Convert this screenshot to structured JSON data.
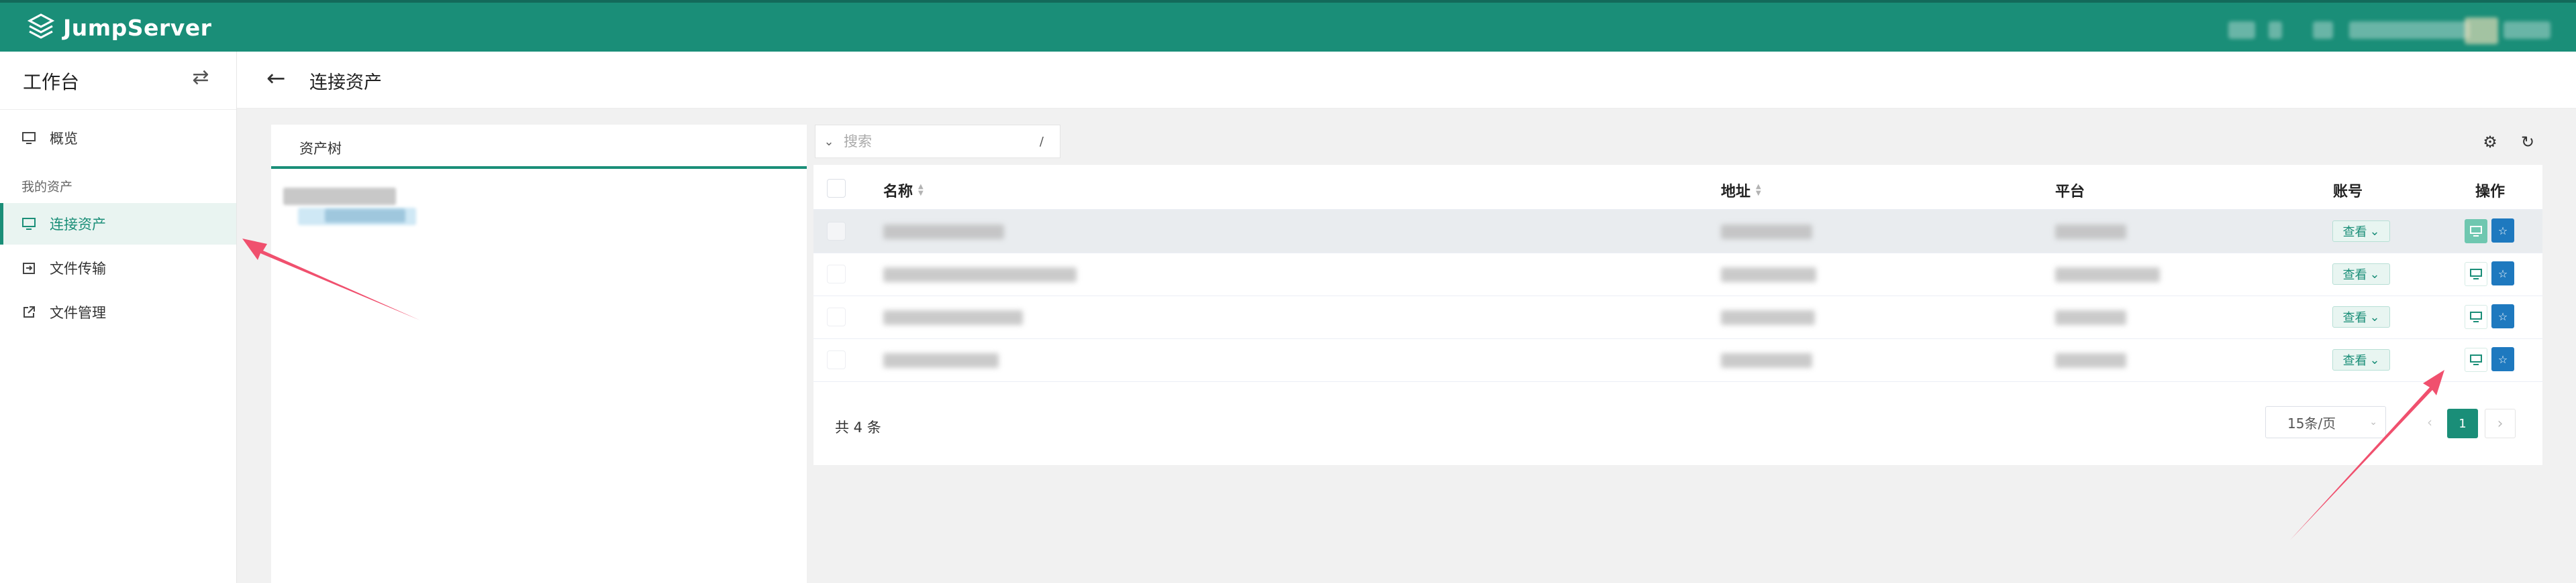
{
  "app": {
    "logo_text": "JumpServer"
  },
  "sidebar": {
    "workspace_title": "工作台",
    "group_label": "我的资产",
    "items": [
      {
        "label": "概览"
      },
      {
        "label": "连接资产"
      },
      {
        "label": "文件传输"
      },
      {
        "label": "文件管理"
      }
    ]
  },
  "header": {
    "title": "连接资产"
  },
  "tree": {
    "tab_label": "资产树"
  },
  "table": {
    "search_placeholder": "搜索",
    "search_shortcut": "/",
    "columns": {
      "name": "名称",
      "address": "地址",
      "platform": "平台",
      "account": "账号",
      "actions": "操作"
    },
    "view_label": "查看",
    "row_count": 4,
    "total_text": "共 4 条",
    "page_size": "15条/页",
    "current_page": "1"
  },
  "colors": {
    "brand": "#1a8e78",
    "favorite": "#1e79bf",
    "annotation_arrow": "#f0506e"
  }
}
